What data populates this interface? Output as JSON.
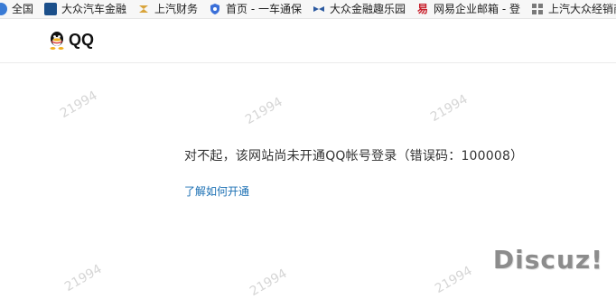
{
  "bookmarks": [
    {
      "label": "全国",
      "icon": "globe-icon",
      "color": "#3a7bd5"
    },
    {
      "label": "大众汽车金融",
      "icon": "vw-finance-icon",
      "color": "#1b4f8a"
    },
    {
      "label": "上汽财务",
      "icon": "saic-icon",
      "color": "#d9a43a"
    },
    {
      "label": "首页 - 一车通保",
      "icon": "shield-icon",
      "color": "#3a6fd8"
    },
    {
      "label": "大众金融趣乐园",
      "icon": "bow-icon",
      "color": "#2c5aa0"
    },
    {
      "label": "网易企业邮箱 - 登",
      "icon": "netease-icon",
      "color": "#c8202c"
    },
    {
      "label": "上汽大众经销商",
      "icon": "grid-icon",
      "color": "#7a7a7a"
    }
  ],
  "header": {
    "brand": "QQ",
    "logo_icon": "qq-penguin-icon"
  },
  "main": {
    "message": "对不起，该网站尚未开通QQ帐号登录（错误码：100008）",
    "help_link": "了解如何开通"
  },
  "watermarks": {
    "number": "21994",
    "brand": "Discuz!"
  },
  "colors": {
    "link": "#1a6fb3",
    "text": "#333333",
    "watermark": "#d6d6d6"
  }
}
